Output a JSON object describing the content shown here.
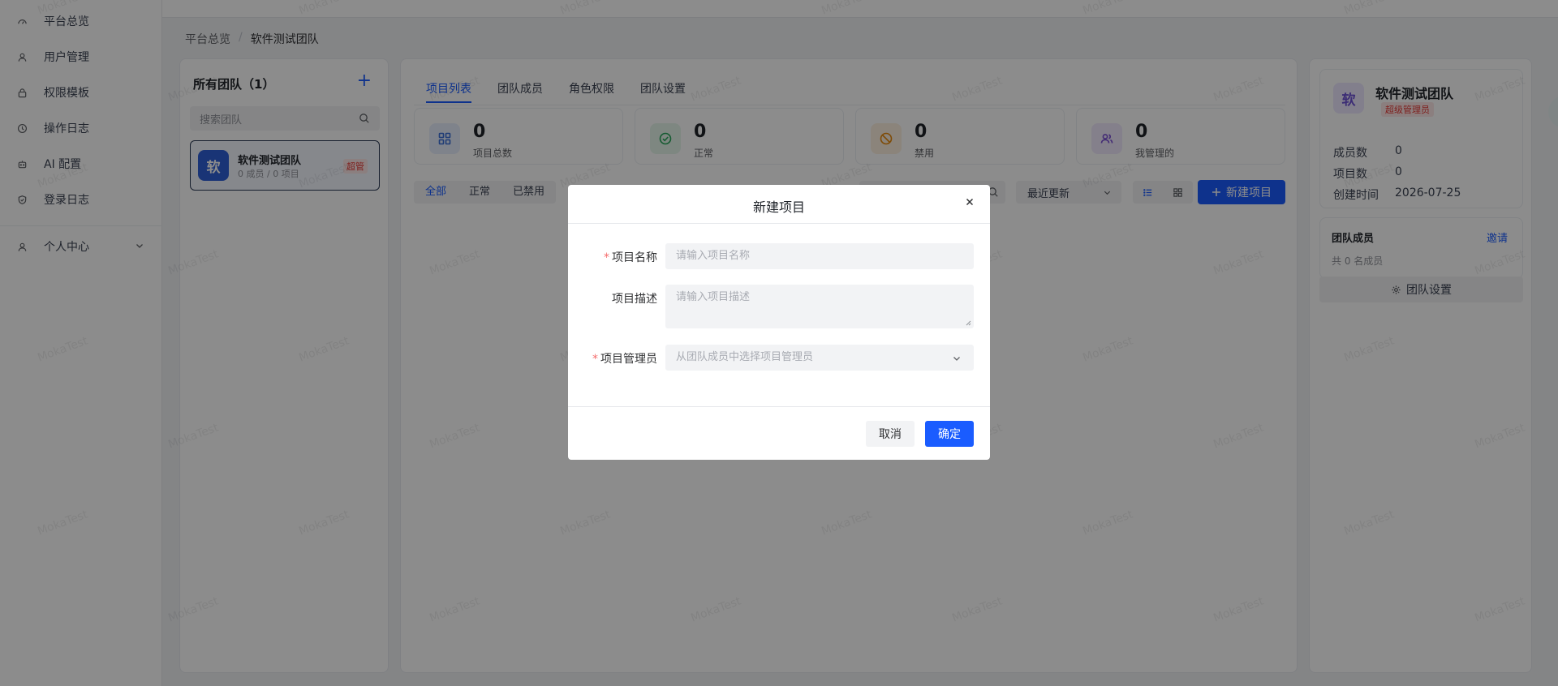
{
  "sidebar": {
    "items": [
      {
        "label": "平台总览",
        "icon": "dashboard-icon"
      },
      {
        "label": "用户管理",
        "icon": "user-icon"
      },
      {
        "label": "权限模板",
        "icon": "lock-icon"
      },
      {
        "label": "操作日志",
        "icon": "clock-icon"
      },
      {
        "label": "AI 配置",
        "icon": "robot-icon"
      },
      {
        "label": "登录日志",
        "icon": "shield-icon"
      }
    ],
    "personal": {
      "label": "个人中心",
      "icon": "user-icon"
    }
  },
  "breadcrumb": {
    "root": "平台总览",
    "separator": "/",
    "current": "软件测试团队"
  },
  "teams_panel": {
    "title": "所有团队（1）",
    "add_label": "+",
    "search_placeholder": "搜索团队",
    "teams": [
      {
        "avatar": "软",
        "name": "软件测试团队",
        "meta": "0 成员 / 0 项目",
        "badge": "超管"
      }
    ]
  },
  "main": {
    "tabs": [
      {
        "label": "项目列表",
        "active": true
      },
      {
        "label": "团队成员",
        "active": false
      },
      {
        "label": "角色权限",
        "active": false
      },
      {
        "label": "团队设置",
        "active": false
      }
    ],
    "stats": [
      {
        "value": "0",
        "label": "项目总数",
        "icon": "grid-icon",
        "color": "#3b6fd8",
        "bg": "#e8effd"
      },
      {
        "value": "0",
        "label": "正常",
        "icon": "check-circle-icon",
        "color": "#27a65a",
        "bg": "#e5f6ec"
      },
      {
        "value": "0",
        "label": "禁用",
        "icon": "ban-icon",
        "color": "#e8890c",
        "bg": "#fdf1e1"
      },
      {
        "value": "0",
        "label": "我管理的",
        "icon": "users-icon",
        "color": "#7b4fd6",
        "bg": "#f0e9fd"
      }
    ],
    "filters": [
      "全部",
      "正常",
      "已禁用"
    ],
    "sort_label": "最近更新",
    "new_button_label": "新建项目"
  },
  "team_info": {
    "avatar": "软",
    "name": "软件测试团队",
    "role": "超级管理员",
    "rows": [
      {
        "key": "成员数",
        "value": "0"
      },
      {
        "key": "项目数",
        "value": "0"
      },
      {
        "key": "创建时间",
        "value": "2026-07-25"
      }
    ],
    "members_title": "团队成员",
    "invite_label": "邀请",
    "members_count": "共 0 名成员",
    "settings_label": "团队设置"
  },
  "watermark": "MokaTest",
  "modal": {
    "title": "新建项目",
    "close_label": "×",
    "fields": {
      "name": {
        "label": "项目名称",
        "required": true,
        "placeholder": "请输入项目名称",
        "value": ""
      },
      "description": {
        "label": "项目描述",
        "required": false,
        "placeholder": "请输入项目描述",
        "value": ""
      },
      "manager": {
        "label": "项目管理员",
        "required": true,
        "placeholder": "从团队成员中选择项目管理员",
        "value": ""
      }
    },
    "cancel_label": "取消",
    "confirm_label": "确定"
  },
  "colors": {
    "primary": "#1a5cff",
    "danger": "#f56c6c",
    "overlay": "rgba(0,0,0,0.45)"
  }
}
